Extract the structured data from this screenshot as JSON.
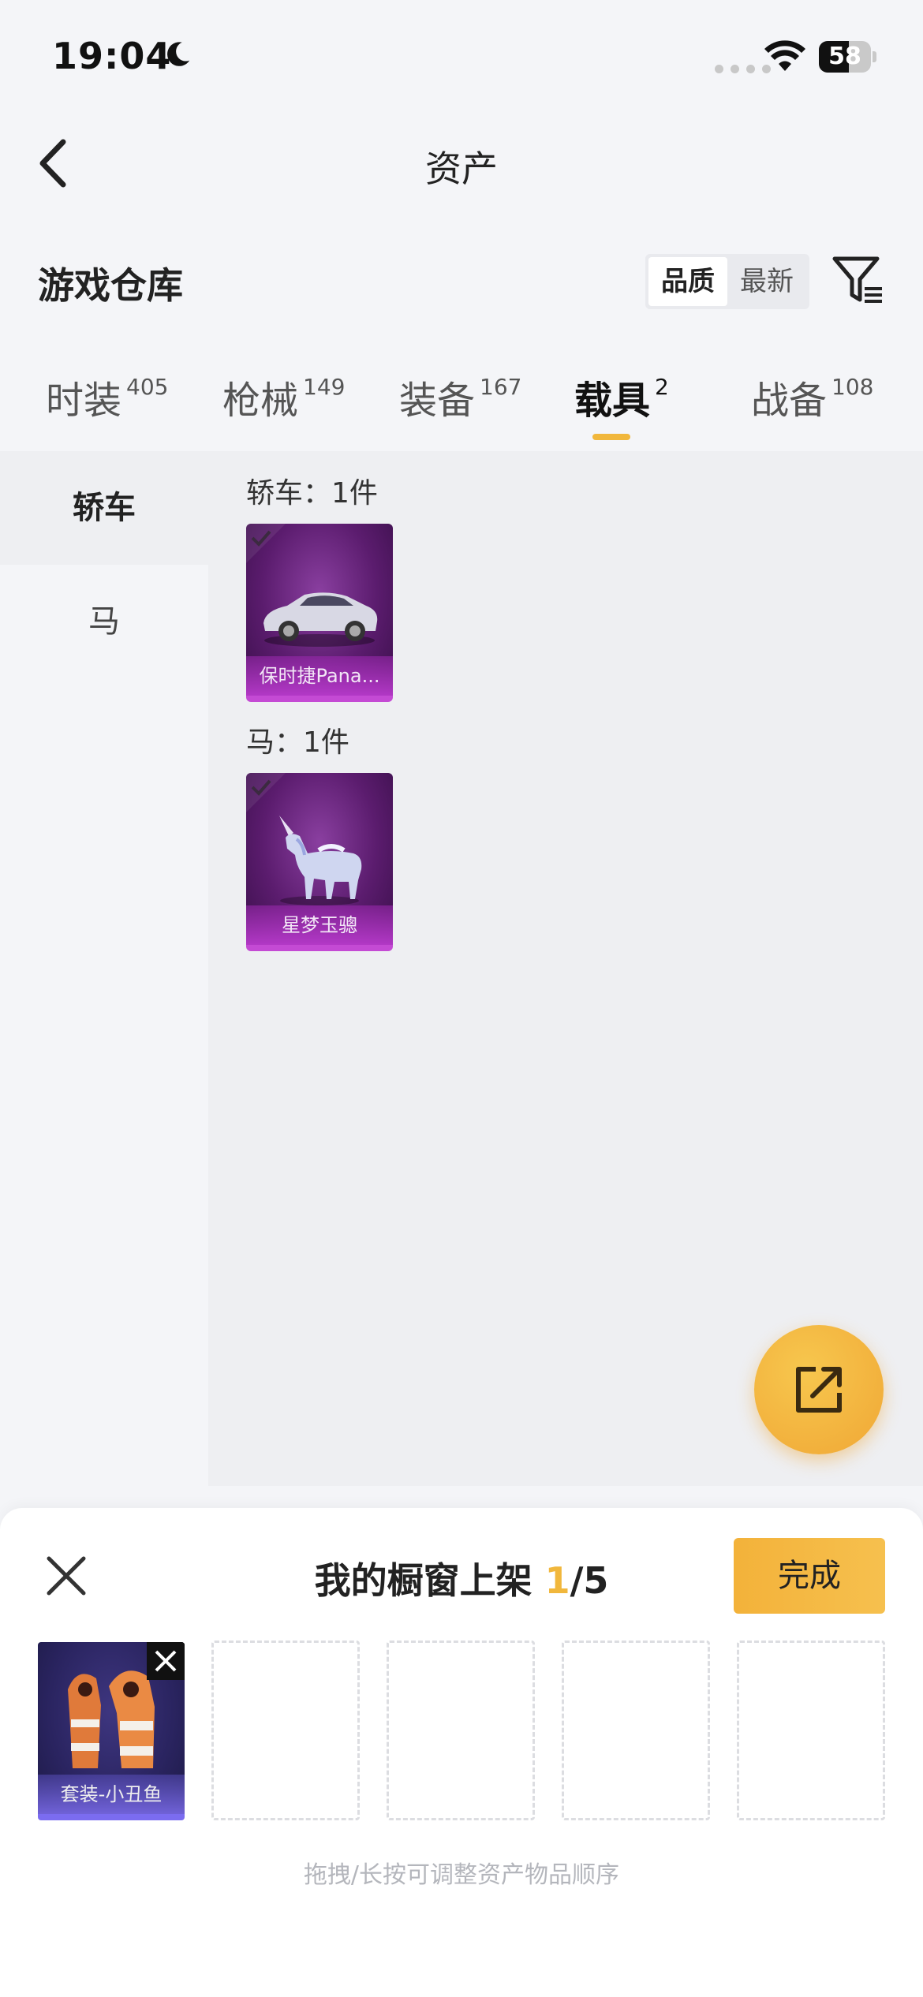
{
  "status_bar": {
    "time": "19:04",
    "battery": "58",
    "battery_level": 0.58
  },
  "header": {
    "title": "资产"
  },
  "section": {
    "title": "游戏仓库"
  },
  "sort": {
    "options": [
      "品质",
      "最新"
    ],
    "active": "品质"
  },
  "tabs": [
    {
      "label": "时装",
      "count": "405"
    },
    {
      "label": "枪械",
      "count": "149"
    },
    {
      "label": "装备",
      "count": "167"
    },
    {
      "label": "载具",
      "count": "2"
    },
    {
      "label": "战备",
      "count": "108"
    }
  ],
  "active_tab": "载具",
  "categories": [
    {
      "label": "轿车"
    },
    {
      "label": "马"
    }
  ],
  "groups": [
    {
      "label": "轿车：1件",
      "items": [
        {
          "name": "保时捷Pana..."
        }
      ]
    },
    {
      "label": "马：1件",
      "items": [
        {
          "name": "星梦玉骢"
        }
      ]
    }
  ],
  "showcase": {
    "title_prefix": "我的橱窗上架 ",
    "count": "1",
    "total": "/5",
    "done_label": "完成",
    "slots": [
      {
        "name": "套装-小丑鱼"
      }
    ],
    "hint": "拖拽/长按可调整资产物品顺序"
  },
  "colors": {
    "accent": "#f1b73c",
    "card_purple": "#5b1c6e",
    "card_blue": "#2a2460"
  },
  "icons": {
    "back": "chevron-left-icon",
    "filter": "filter-icon",
    "share": "share-icon",
    "close": "close-icon"
  }
}
